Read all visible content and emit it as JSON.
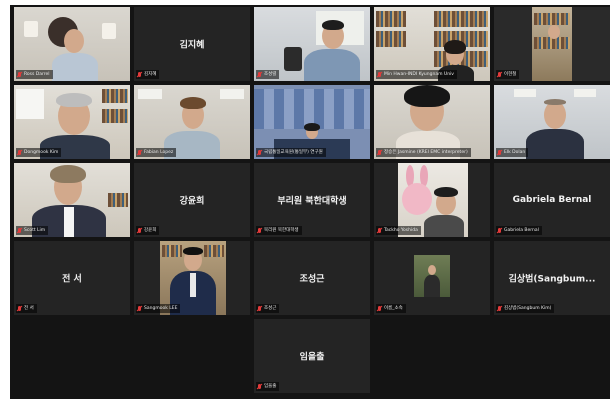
{
  "meeting": {
    "tiles": [
      {
        "name": "Ross Darrel",
        "display": null
      },
      {
        "name": "김지혜",
        "display": "김지혜"
      },
      {
        "name": "조성렬",
        "display": null
      },
      {
        "name": "Min Hwan-INDI Kyungnam Univ",
        "display": null
      },
      {
        "name": "이현철",
        "display": null
      },
      {
        "name": "Dongmook Kim",
        "display": null
      },
      {
        "name": "Fabian Lopez",
        "display": null
      },
      {
        "name": "국립통일교육원(통일부) 연구원",
        "display": null
      },
      {
        "name": "정승은 Jasmine (KREI EMC interpreter)",
        "display": null
      },
      {
        "name": "Elk Dolan",
        "display": null
      },
      {
        "name": "Scott Lim",
        "display": null
      },
      {
        "name": "강윤희",
        "display": "강윤희"
      },
      {
        "name": "북리원 북한대학생",
        "display": "부리원 북한대학생"
      },
      {
        "name": "Tackho Yoshida",
        "display": null
      },
      {
        "name": "Gabriela Bernal",
        "display": "Gabriela Bernal"
      },
      {
        "name": "전 서",
        "display": "전 서"
      },
      {
        "name": "Sangmook LEE",
        "display": null
      },
      {
        "name": "조성근",
        "display": "조성근"
      },
      {
        "name": "이름_소속",
        "display": null
      },
      {
        "name": "김상범(Sangbum Kim)",
        "display": "김상범(Sangbum..."
      },
      {
        "name": "임을출",
        "display": "임을출"
      }
    ]
  },
  "colors": {
    "background": "#141414",
    "tile": "#242424",
    "active_border": "#c8e03a",
    "muted_mic": "#e23b3b"
  }
}
